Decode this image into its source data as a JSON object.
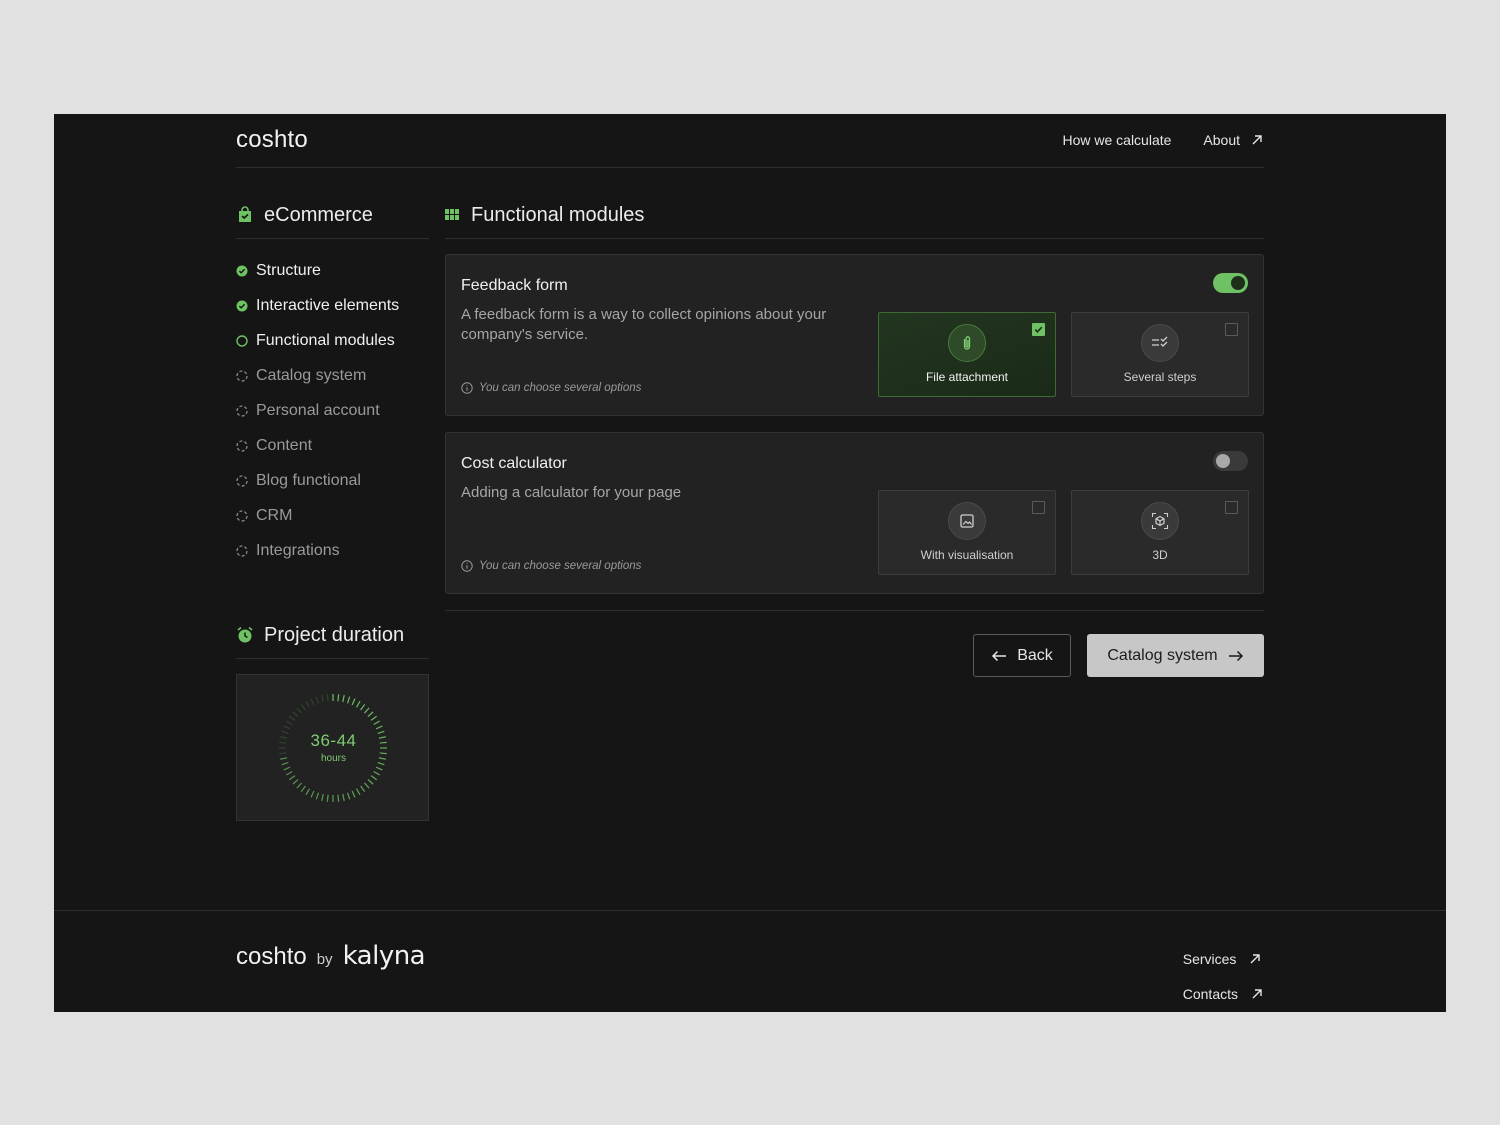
{
  "header": {
    "logo": "coshto",
    "nav": [
      {
        "label": "How we calculate"
      },
      {
        "label": "About"
      }
    ]
  },
  "sidebar": {
    "title": "eCommerce",
    "steps": [
      {
        "label": "Structure",
        "state": "done"
      },
      {
        "label": "Interactive elements",
        "state": "done"
      },
      {
        "label": "Functional modules",
        "state": "active"
      },
      {
        "label": "Catalog system",
        "state": "todo"
      },
      {
        "label": "Personal account",
        "state": "todo"
      },
      {
        "label": "Content",
        "state": "todo"
      },
      {
        "label": "Blog functional",
        "state": "todo"
      },
      {
        "label": "CRM",
        "state": "todo"
      },
      {
        "label": "Integrations",
        "state": "todo"
      }
    ]
  },
  "duration": {
    "title": "Project duration",
    "value": "36-44",
    "unit": "hours"
  },
  "main": {
    "title": "Functional modules",
    "cards": [
      {
        "title": "Feedback form",
        "description": "A feedback form is a way to collect opinions about your company's service.",
        "note": "You can choose several options",
        "enabled": true,
        "options": [
          {
            "label": "File attachment",
            "icon": "paperclip-icon",
            "checked": true
          },
          {
            "label": "Several steps",
            "icon": "steps-icon",
            "checked": false
          }
        ]
      },
      {
        "title": "Cost calculator",
        "description": "Adding a calculator for your page",
        "note": "You can choose several options",
        "enabled": false,
        "options": [
          {
            "label": "With visualisation",
            "icon": "image-icon",
            "checked": false
          },
          {
            "label": "3D",
            "icon": "cube-3d-icon",
            "checked": false
          }
        ]
      }
    ],
    "back_label": "Back",
    "next_label": "Catalog system"
  },
  "footer": {
    "logo_a": "coshto",
    "logo_by": "by",
    "logo_b": "kalyna",
    "links": [
      {
        "label": "Services"
      },
      {
        "label": "Contacts"
      }
    ]
  },
  "colors": {
    "accent": "#6ec263",
    "background": "#151515",
    "card": "#222222",
    "page": "#e1e1e1"
  }
}
